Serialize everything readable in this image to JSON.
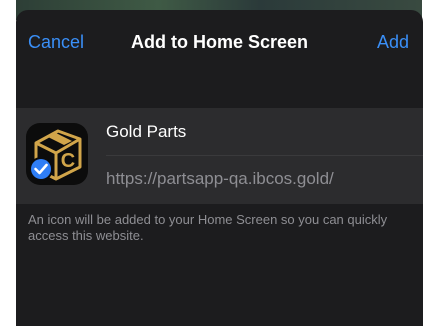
{
  "navbar": {
    "cancel_label": "Cancel",
    "title": "Add to Home Screen",
    "add_label": "Add"
  },
  "app": {
    "name": "Gold Parts",
    "url": "https://partsapp-qa.ibcos.gold/",
    "icon": "gold-parts-box-icon",
    "badge_icon": "checkmark-badge-icon"
  },
  "caption": "An icon will be added to your Home Screen so you can quickly access this website.",
  "colors": {
    "accent": "#3a8ff7",
    "sheet_background": "#1c1c1e",
    "card_background": "#2c2c2e",
    "secondary_text": "#8e8e93",
    "icon_gold": "#d1a54a"
  }
}
